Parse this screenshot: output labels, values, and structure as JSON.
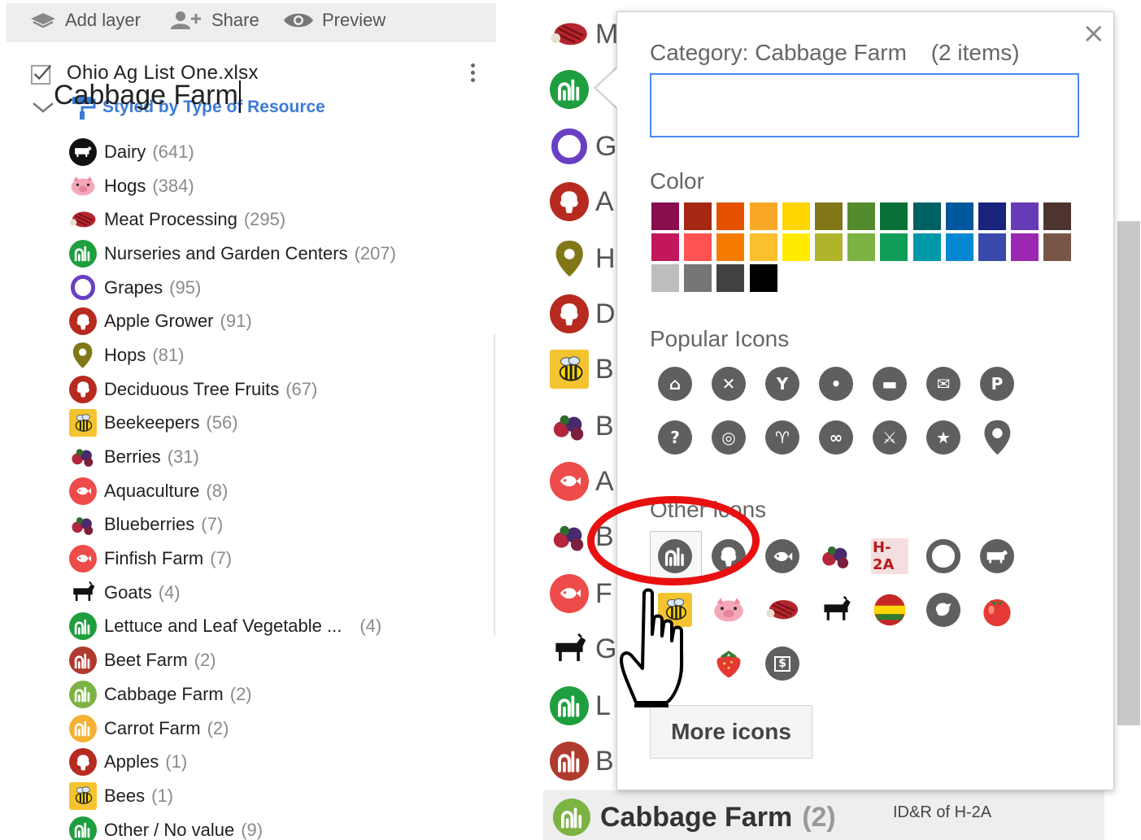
{
  "toolbar": {
    "add_layer": "Add layer",
    "share": "Share",
    "preview": "Preview"
  },
  "layer": {
    "name": "Ohio Ag List One.xlsx",
    "styled_by": "Styled by Type of Resource"
  },
  "categories": [
    {
      "label": "Dairy",
      "count": "(641)",
      "icon": "cow-icon",
      "color": "#111111"
    },
    {
      "label": "Hogs",
      "count": "(384)",
      "icon": "pig-icon",
      "color": "#f4a7b9"
    },
    {
      "label": "Meat Processing",
      "count": "(295)",
      "icon": "steak-icon",
      "color": "#b3262e"
    },
    {
      "label": "Nurseries and Garden Centers",
      "count": "(207)",
      "icon": "plant-icon",
      "color": "#1e9e3e"
    },
    {
      "label": "Grapes",
      "count": "(95)",
      "icon": "circle-icon",
      "color": "#6a3fc4"
    },
    {
      "label": "Apple Grower",
      "count": "(91)",
      "icon": "tree-icon",
      "color": "#b72a20"
    },
    {
      "label": "Hops",
      "count": "(81)",
      "icon": "pin-icon",
      "color": "#827717"
    },
    {
      "label": "Deciduous Tree Fruits",
      "count": "(67)",
      "icon": "tree-icon",
      "color": "#b72a20"
    },
    {
      "label": "Beekeepers",
      "count": "(56)",
      "icon": "bee-icon",
      "color": "#f4c430"
    },
    {
      "label": "Berries",
      "count": "(31)",
      "icon": "berries-icon",
      "color": "#7b1f3c"
    },
    {
      "label": "Aquaculture",
      "count": "(8)",
      "icon": "fish-icon",
      "color": "#ee4b4b"
    },
    {
      "label": "Blueberries",
      "count": "(7)",
      "icon": "berries-icon",
      "color": "#7b1f3c"
    },
    {
      "label": "Finfish Farm",
      "count": "(7)",
      "icon": "fish-icon",
      "color": "#ee4b4b"
    },
    {
      "label": "Goats",
      "count": "(4)",
      "icon": "goat-icon",
      "color": "#111111"
    },
    {
      "label": "Lettuce and Leaf Vegetable ...",
      "count": "(4)",
      "icon": "plant-icon",
      "color": "#1e9e3e"
    },
    {
      "label": "Beet Farm",
      "count": "(2)",
      "icon": "plant-icon",
      "color": "#b03a2e"
    },
    {
      "label": "Cabbage Farm",
      "count": "(2)",
      "icon": "plant-icon",
      "color": "#7cb342"
    },
    {
      "label": "Carrot Farm",
      "count": "(2)",
      "icon": "plant-icon",
      "color": "#f4b133"
    },
    {
      "label": "Apples",
      "count": "(1)",
      "icon": "tree-icon",
      "color": "#b72a20"
    },
    {
      "label": "Bees",
      "count": "(1)",
      "icon": "bee-icon",
      "color": "#f4c430"
    },
    {
      "label": "Other / No value",
      "count": "(9)",
      "icon": "plant-icon",
      "color": "#1e9e3e"
    }
  ],
  "middle_strip": [
    {
      "letter": "M",
      "icon": "steak-icon",
      "color": "#b3262e"
    },
    {
      "letter": "",
      "icon": "plant-icon",
      "color": "#1e9e3e"
    },
    {
      "letter": "G",
      "icon": "circle-icon",
      "color": "#6a3fc4"
    },
    {
      "letter": "A",
      "icon": "tree-icon",
      "color": "#b72a20"
    },
    {
      "letter": "H",
      "icon": "pin-icon",
      "color": "#827717"
    },
    {
      "letter": "D",
      "icon": "tree-icon",
      "color": "#b72a20"
    },
    {
      "letter": "B",
      "icon": "bee-icon",
      "color": "#f4c430"
    },
    {
      "letter": "B",
      "icon": "berries-icon",
      "color": "#7b1f3c"
    },
    {
      "letter": "A",
      "icon": "fish-icon",
      "color": "#ee4b4b"
    },
    {
      "letter": "B",
      "icon": "berries-icon",
      "color": "#7b1f3c"
    },
    {
      "letter": "F",
      "icon": "fish-icon",
      "color": "#ee4b4b"
    },
    {
      "letter": "G",
      "icon": "goat-icon",
      "color": "#111111"
    },
    {
      "letter": "L",
      "icon": "plant-icon",
      "color": "#1e9e3e"
    },
    {
      "letter": "B",
      "icon": "plant-icon",
      "color": "#b03a2e"
    }
  ],
  "footer": {
    "label": "Cabbage Farm",
    "count": "(2)",
    "note": "ID&R of H-2A",
    "icon_color": "#7cb342"
  },
  "popup": {
    "title_prefix": "Category:",
    "title_name": "Cabbage Farm",
    "title_items": "(2 items)",
    "name_value": "Cabbage Farm",
    "color_heading": "Color",
    "popular_heading": "Popular Icons",
    "other_heading": "Other icons",
    "more_icons": "More icons",
    "close": "×",
    "palette_row1": [
      "#880e4f",
      "#a52714",
      "#e65100",
      "#f9a825",
      "#ffd600",
      "#817717",
      "#558b2f",
      "#097138",
      "#006064",
      "#01579b",
      "#1a237e",
      "#673ab7",
      "#4e342e"
    ],
    "palette_row2": [
      "#c2185b",
      "#ff5252",
      "#f57c00",
      "#fbc02d",
      "#ffea00",
      "#afb42b",
      "#7cb342",
      "#0f9d58",
      "#0097a7",
      "#0288d1",
      "#3949ab",
      "#9c27b0",
      "#795548"
    ],
    "palette_row3": [
      "#bdbdbd",
      "#757575",
      "#424242",
      "#000000"
    ],
    "popular_icons": [
      "home-icon",
      "restaurant-icon",
      "cocktail-icon",
      "dentist-icon",
      "hotel-icon",
      "shopping-icon",
      "parking-icon",
      "help-icon",
      "camera-icon",
      "hiking-icon",
      "cycling-icon",
      "running-icon",
      "star-icon",
      "pin-icon"
    ],
    "popular_glyphs": [
      "⌂",
      "✕",
      "Y",
      "•",
      "▬",
      "✉",
      "P",
      "?",
      "◎",
      "♈",
      "∞",
      "⚔",
      "★",
      ""
    ],
    "other_icons": [
      "plant-icon",
      "tree-icon",
      "fish-icon",
      "berries-icon",
      "h2a-icon",
      "circle-icon",
      "cow-icon",
      "bee-icon",
      "pig-icon",
      "steak-icon",
      "goat-icon",
      "flag-icon",
      "bird-icon",
      "tomato-icon",
      "hand-icon",
      "strawberry-icon",
      "dollar-icon"
    ],
    "h2a_text": "H-2A",
    "dollar_text": "$"
  }
}
